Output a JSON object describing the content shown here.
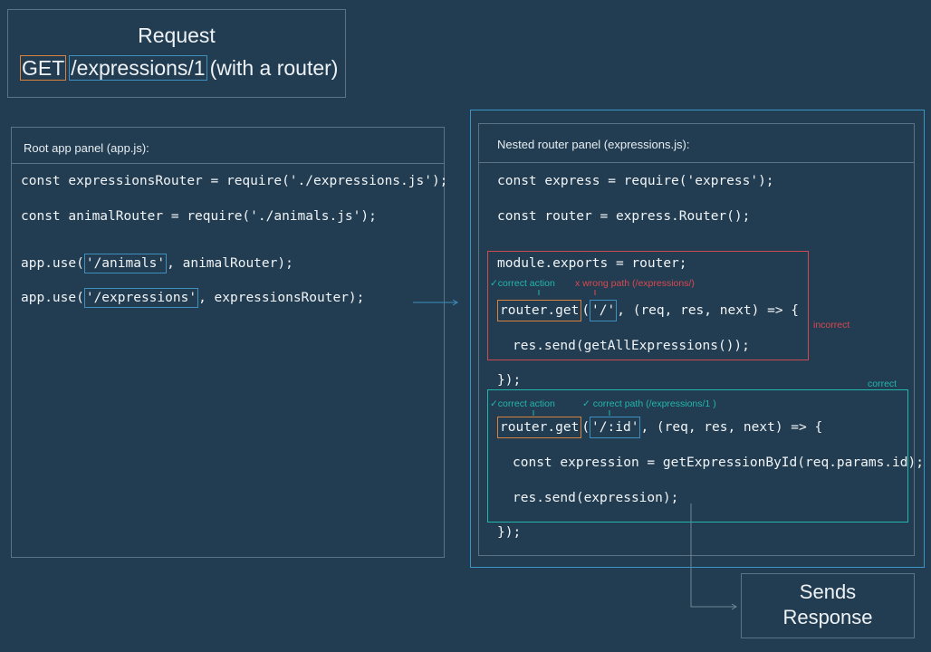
{
  "request": {
    "title": "Request",
    "method": "GET",
    "path": "/expressions/1",
    "suffix": "(with a router)"
  },
  "root_panel": {
    "title": "Root app panel (app.js):",
    "lines": {
      "l1": "const expressionsRouter = require('./expressions.js');",
      "l2": "const animalRouter = require('./animals.js');",
      "l3_pre": "app.use(",
      "l3_path": "'/animals'",
      "l3_post": ", animalRouter);",
      "l4_pre": "app.use(",
      "l4_path": "'/expressions'",
      "l4_post": ", expressionsRouter);"
    }
  },
  "nested_panel": {
    "title": "Nested router panel (expressions.js):",
    "lines": {
      "l1": "const express = require('express');",
      "l2": "const router = express.Router();",
      "l3": "module.exports = router;",
      "l4_method": "router.get",
      "l4_paren": "(",
      "l4_path": "'/'",
      "l4_post": ", (req, res, next) => {",
      "l5": "res.send(getAllExpressions());",
      "l6": "});",
      "l7_method": "router.get",
      "l7_paren": "(",
      "l7_path": "'/:id'",
      "l7_post": ", (req, res, next) => {",
      "l8": "const expression = getExpressionById(req.params.id);",
      "l9": "res.send(expression);",
      "l10": "});"
    },
    "annotations": {
      "correct_action_1": "✓correct action",
      "wrong_path": "x wrong path (/expressions/)",
      "incorrect": "incorrect",
      "correct": "correct",
      "correct_action_2": "✓correct action",
      "correct_path": "✓ correct path (/expressions/1 )"
    }
  },
  "response": {
    "line1": "Sends",
    "line2": "Response"
  },
  "colors": {
    "background": "#223d52",
    "orange": "#d9823e",
    "blue": "#3f8fbf",
    "teal": "#22b6ad",
    "red": "#d9484f"
  }
}
